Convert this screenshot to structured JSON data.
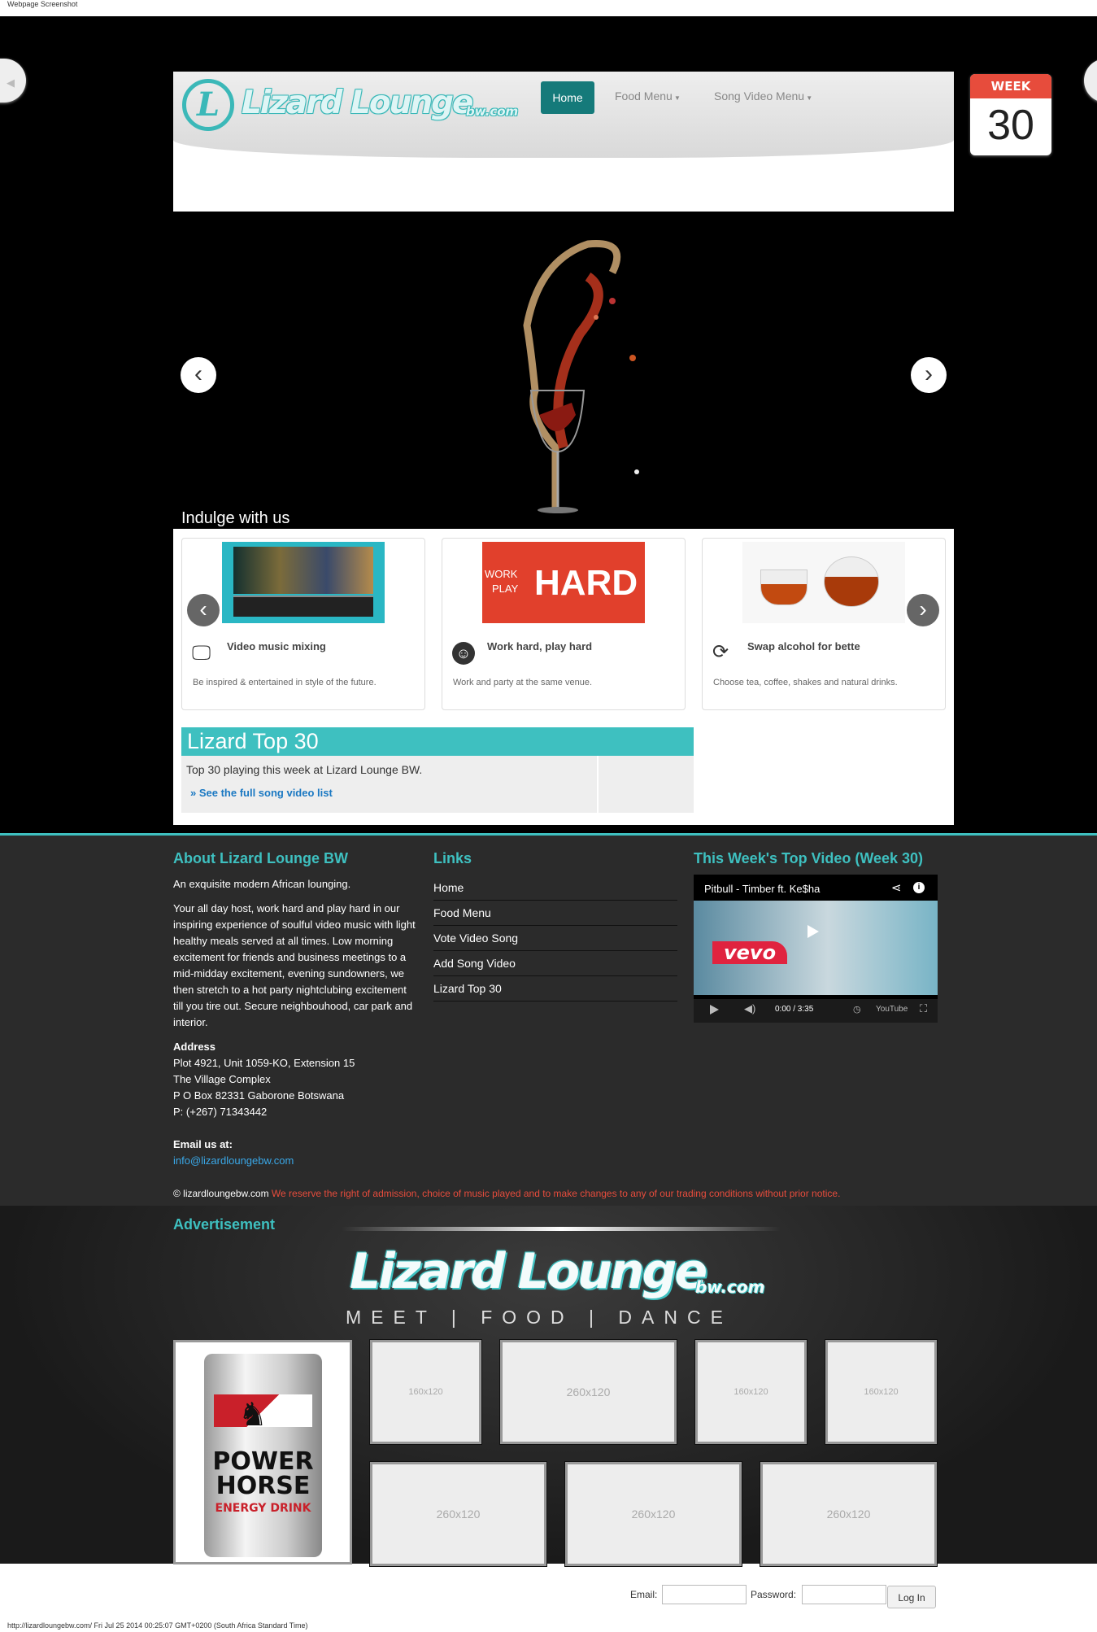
{
  "window": {
    "title": "Webpage Screenshot",
    "status_line": "http://lizardloungebw.com/ Fri Jul 25 2014 00:25:07 GMT+0200 (South Africa Standard Time)"
  },
  "logo": {
    "mark": "L",
    "name": "Lizard Lounge",
    "suffix": "bw.com"
  },
  "nav": {
    "home": "Home",
    "food": "Food Menu",
    "song": "Song Video Menu"
  },
  "calendar": {
    "label": "WEEK",
    "number": "30"
  },
  "slider": {
    "caption": "Indulge with us"
  },
  "cards": [
    {
      "title": "Video music mixing",
      "desc": "Be inspired & entertained in style of the future.",
      "icon": "monitor-icon"
    },
    {
      "title": "Work hard, play hard",
      "desc": "Work and party at the same venue.",
      "icon": "smiley-icon",
      "img_text_1": "WORK",
      "img_text_2": "PLAY",
      "img_text_3": "HARD"
    },
    {
      "title": "Swap alcohol for bette",
      "desc": "Choose tea, coffee, shakes and natural drinks.",
      "icon": "refresh-icon"
    }
  ],
  "top30": {
    "title": "Lizard Top 30",
    "text": "Top 30 playing this week at Lizard Lounge BW.",
    "link": "» See the full song video list"
  },
  "footer": {
    "about_title": "About Lizard Lounge BW",
    "about_lead": "An exquisite modern African lounging.",
    "about_body": "Your all day host, work hard and play hard in our inspiring experience of soulful video music with light healthy meals served at all times. Low morning excitement for friends and business meetings to a mid-midday excitement, evening sundowners, we then stretch to a hot party nightclubing excitement till you tire out. Secure neighbouhood, car park and interior.",
    "address_label": "Address",
    "address_lines": [
      "Plot 4921, Unit 1059-KO, Extension 15",
      "The Village Complex",
      "P O Box 82331 Gaborone Botswana",
      "P: (+267) 71343442"
    ],
    "email_label": "Email us at:",
    "email": "info@lizardloungebw.com",
    "links_title": "Links",
    "links": [
      "Home",
      "Food Menu",
      "Vote Video Song",
      "Add Song Video",
      "Lizard Top 30"
    ],
    "video_title": "This Week's Top Video (Week 30)",
    "video": {
      "name": "Pitbull - Timber ft. Ke$ha",
      "brand": "vevo",
      "time": "0:00 / 3:35",
      "youtube": "YouTube"
    },
    "copyright_site": "© lizardloungebw.com",
    "copyright_note": "We reserve the right of admission, choice of music played and to make changes to any of our trading conditions without prior notice."
  },
  "ads": {
    "heading": "Advertisement",
    "banner_name": "Lizard Lounge",
    "banner_suffix": "bw.com",
    "tagline": "MEET  |  FOOD  |  DANCE",
    "product": {
      "line1": "POWER",
      "line2": "HORSE",
      "line3": "ENERGY DRINK"
    },
    "slots": [
      "160x120",
      "260x120",
      "160x120",
      "160x120",
      "260x120",
      "260x120",
      "260x120"
    ]
  },
  "login": {
    "email_label": "Email:",
    "password_label": "Password:",
    "button": "Log In"
  }
}
